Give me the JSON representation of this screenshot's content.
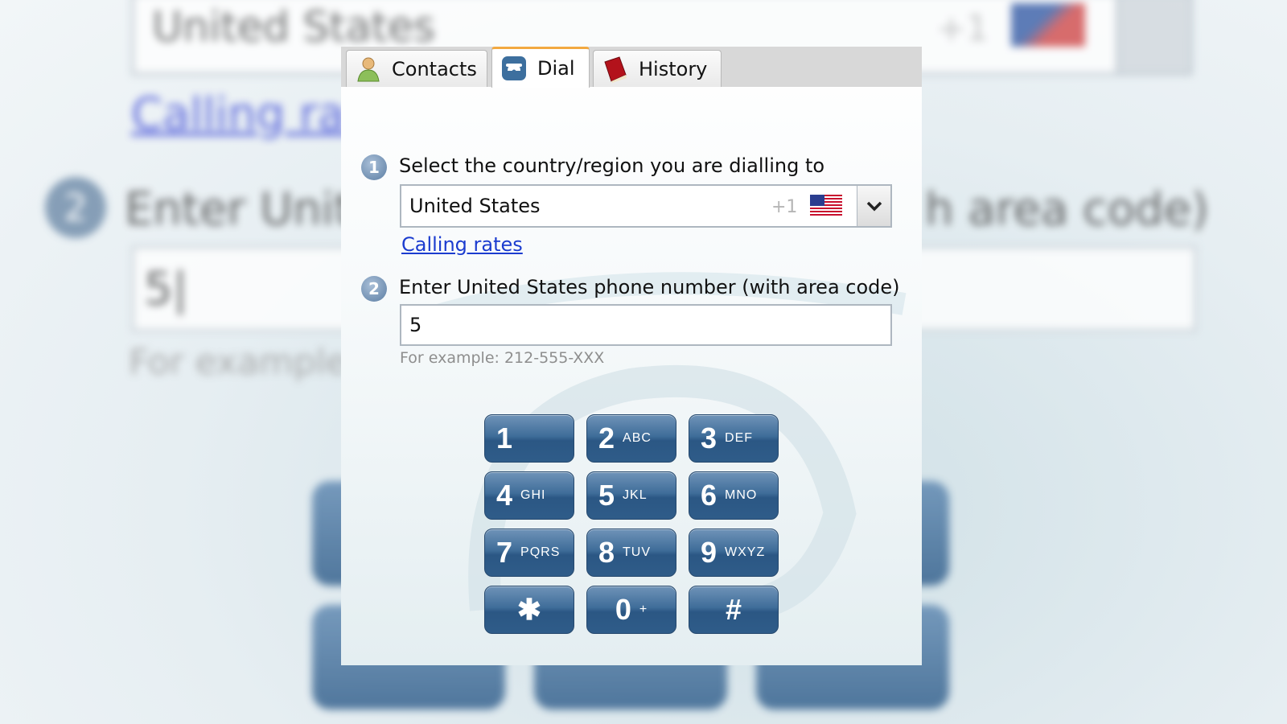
{
  "background": {
    "country": "United States",
    "code": "+1",
    "link": "Calling rate",
    "step_number": "2",
    "step_text_left": "Enter Unite",
    "step_text_right": "h area code)",
    "phone_value": "5|",
    "example": "For example"
  },
  "tabs": [
    {
      "label": "Contacts",
      "icon": "contacts-icon",
      "active": false
    },
    {
      "label": "Dial",
      "icon": "phone-icon",
      "active": true
    },
    {
      "label": "History",
      "icon": "history-book-icon",
      "active": false
    }
  ],
  "step1": {
    "number": "1",
    "text": "Select the country/region you are dialling to"
  },
  "country_select": {
    "value": "United States",
    "code": "+1",
    "flag": "us-flag-icon"
  },
  "rates_link": "Calling rates",
  "step2": {
    "number": "2",
    "text": "Enter United States phone number (with area code)"
  },
  "phone_input": {
    "value": "5"
  },
  "example_text": "For example: 212-555-XXX",
  "keypad": [
    {
      "num": "1",
      "letters": ""
    },
    {
      "num": "2",
      "letters": "ABC"
    },
    {
      "num": "3",
      "letters": "DEF"
    },
    {
      "num": "4",
      "letters": "GHI"
    },
    {
      "num": "5",
      "letters": "JKL"
    },
    {
      "num": "6",
      "letters": "MNO"
    },
    {
      "num": "7",
      "letters": "PQRS"
    },
    {
      "num": "8",
      "letters": "TUV"
    },
    {
      "num": "9",
      "letters": "WXYZ"
    },
    {
      "num": "✱",
      "letters": ""
    },
    {
      "num": "0",
      "letters": "+"
    },
    {
      "num": "#",
      "letters": ""
    }
  ],
  "colors": {
    "accent_tab": "#f2a940",
    "link": "#1b3ccf",
    "key": "#3f6d99"
  }
}
